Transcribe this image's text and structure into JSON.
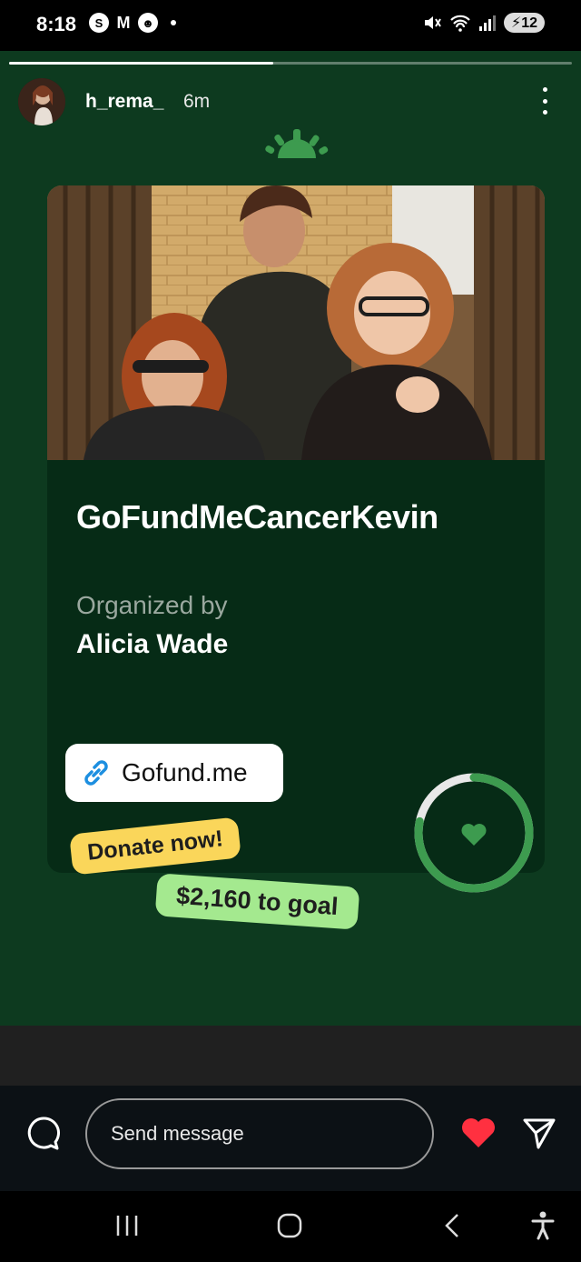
{
  "status_bar": {
    "time": "8:18",
    "notification_icons": [
      "S",
      "M",
      "☻"
    ],
    "battery": "12"
  },
  "story": {
    "username": "h_rema_",
    "time_ago": "6m",
    "progress": 0.47,
    "card": {
      "title": "GoFundMeCancerKevin",
      "organized_by_label": "Organized by",
      "organizer": "Alicia Wade",
      "link_label": "Gofund.me",
      "donate_tag": "Donate now!",
      "goal_tag": "$2,160 to goal"
    },
    "colors": {
      "story_bg": "#0d3a1f",
      "card_bg": "#062b16",
      "accent_green": "#3d9b4f",
      "donate_yellow": "#fad65a",
      "goal_green": "#a4e98f"
    }
  },
  "reply": {
    "placeholder": "Send message"
  },
  "icons": [
    "chat-bubble-icon",
    "heart-icon",
    "send-icon",
    "recent-apps-icon",
    "home-icon",
    "back-icon",
    "accessibility-icon",
    "link-icon",
    "more-icon"
  ]
}
